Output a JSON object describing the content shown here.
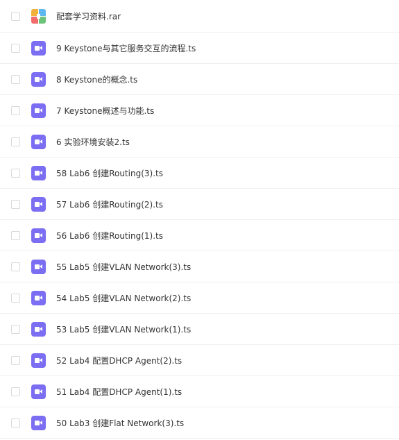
{
  "files": [
    {
      "name": "配套学习资料.rar",
      "icon": "archive-icon"
    },
    {
      "name": "9 Keystone与其它服务交互的流程.ts",
      "icon": "video-icon"
    },
    {
      "name": "8 Keystone的概念.ts",
      "icon": "video-icon"
    },
    {
      "name": "7 Keystone概述与功能.ts",
      "icon": "video-icon"
    },
    {
      "name": "6 实验环境安装2.ts",
      "icon": "video-icon"
    },
    {
      "name": "58 Lab6 创建Routing(3).ts",
      "icon": "video-icon"
    },
    {
      "name": "57 Lab6 创建Routing(2).ts",
      "icon": "video-icon"
    },
    {
      "name": "56 Lab6 创建Routing(1).ts",
      "icon": "video-icon"
    },
    {
      "name": "55 Lab5 创建VLAN Network(3).ts",
      "icon": "video-icon"
    },
    {
      "name": "54 Lab5 创建VLAN Network(2).ts",
      "icon": "video-icon"
    },
    {
      "name": "53 Lab5 创建VLAN Network(1).ts",
      "icon": "video-icon"
    },
    {
      "name": "52 Lab4 配置DHCP Agent(2).ts",
      "icon": "video-icon"
    },
    {
      "name": "51 Lab4 配置DHCP Agent(1).ts",
      "icon": "video-icon"
    },
    {
      "name": "50 Lab3 创建Flat Network(3).ts",
      "icon": "video-icon"
    }
  ],
  "colors": {
    "video_icon": "#7c6ef2",
    "text": "#333333",
    "divider": "#f0f0f0"
  }
}
